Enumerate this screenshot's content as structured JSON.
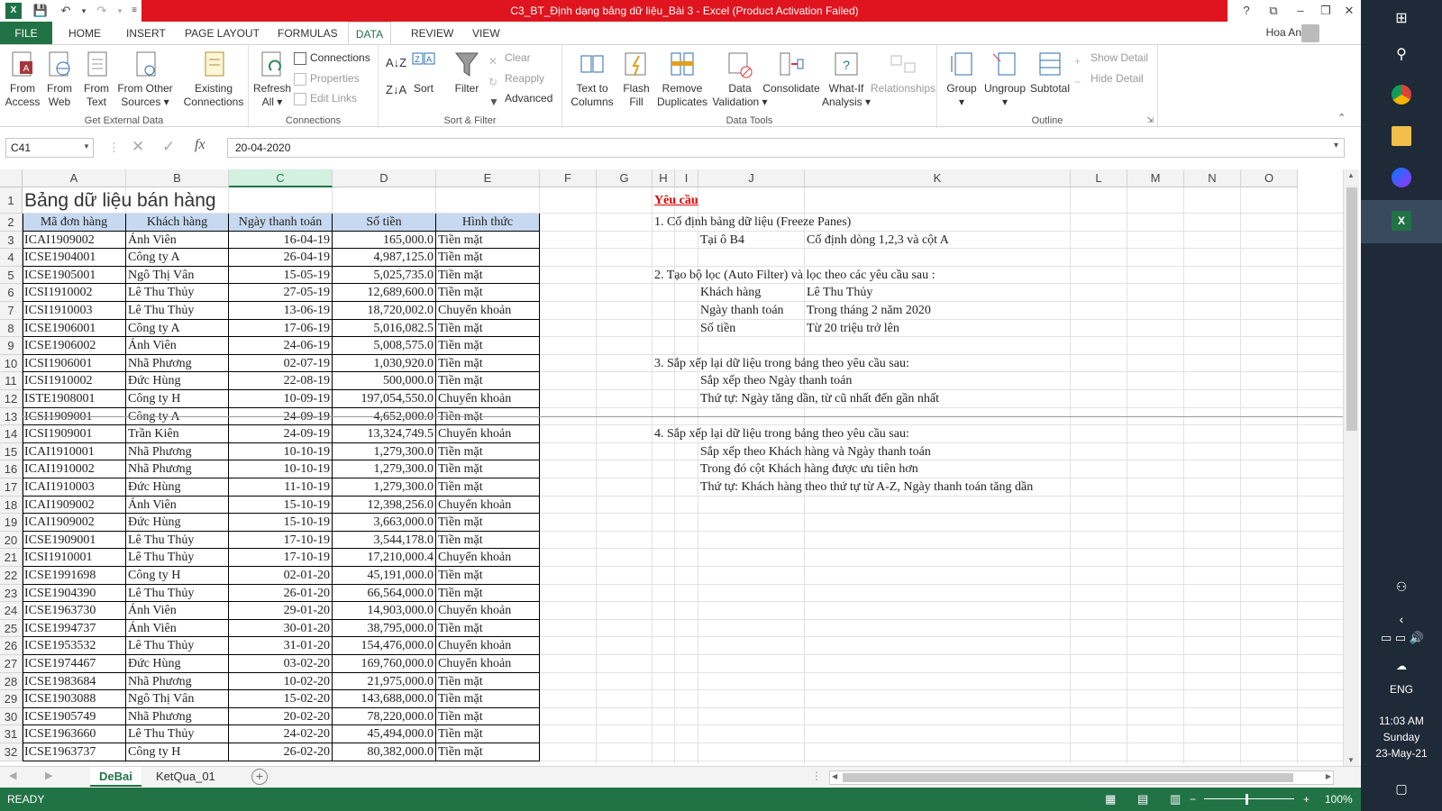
{
  "window": {
    "title": "C3_BT_Định dạng bảng dữ liệu_Bài 3 -  Excel (Product Activation Failed)",
    "user": "Hoa An",
    "help": "?"
  },
  "ribbon_tabs": [
    "FILE",
    "HOME",
    "INSERT",
    "PAGE LAYOUT",
    "FORMULAS",
    "DATA",
    "REVIEW",
    "VIEW"
  ],
  "ribbon": {
    "get_external": {
      "label": "Get External Data",
      "from_access": [
        "From",
        "Access"
      ],
      "from_web": [
        "From",
        "Web"
      ],
      "from_text": [
        "From",
        "Text"
      ],
      "from_other": [
        "From Other",
        "Sources ▾"
      ],
      "existing": [
        "Existing",
        "Connections"
      ]
    },
    "connections": {
      "label": "Connections",
      "refresh": [
        "Refresh",
        "All ▾"
      ],
      "connections": "Connections",
      "properties": "Properties",
      "edit_links": "Edit Links"
    },
    "sort_filter": {
      "label": "Sort & Filter",
      "sort": "Sort",
      "filter": "Filter",
      "clear": "Clear",
      "reapply": "Reapply",
      "advanced": "Advanced"
    },
    "data_tools": {
      "label": "Data Tools",
      "text_to_columns": [
        "Text to",
        "Columns"
      ],
      "flash_fill": [
        "Flash",
        "Fill"
      ],
      "remove_duplicates": [
        "Remove",
        "Duplicates"
      ],
      "data_validation": [
        "Data",
        "Validation ▾"
      ],
      "consolidate": "Consolidate",
      "what_if": [
        "What-If",
        "Analysis ▾"
      ],
      "relationships": "Relationships"
    },
    "outline": {
      "label": "Outline",
      "group": "Group",
      "ungroup": "Ungroup",
      "subtotal": "Subtotal",
      "show_detail": "Show Detail",
      "hide_detail": "Hide Detail"
    }
  },
  "formula_bar": {
    "name_box": "C41",
    "value": "20-04-2020"
  },
  "columns": [
    "A",
    "B",
    "C",
    "D",
    "E",
    "F",
    "G",
    "H",
    "I",
    "J",
    "K",
    "L",
    "M",
    "N",
    "O"
  ],
  "sheet_title": "Bảng dữ liệu bán hàng",
  "table_headers": [
    "Mã đơn hàng",
    "Khách hàng",
    "Ngày thanh toán",
    "Số tiền",
    "Hình thức"
  ],
  "rows": [
    [
      "ICAI1909002",
      "Ánh Viên",
      "16-04-19",
      "165,000.0",
      "Tiền mặt"
    ],
    [
      "ICSE1904001",
      "Công ty A",
      "26-04-19",
      "4,987,125.0",
      "Tiền mặt"
    ],
    [
      "ICSE1905001",
      "Ngô Thị Vân",
      "15-05-19",
      "5,025,735.0",
      "Tiền mặt"
    ],
    [
      "ICSI1910002",
      "Lê Thu Thủy",
      "27-05-19",
      "12,689,600.0",
      "Tiền mặt"
    ],
    [
      "ICSI1910003",
      "Lê Thu Thủy",
      "13-06-19",
      "18,720,002.0",
      "Chuyển khoản"
    ],
    [
      "ICSE1906001",
      "Công ty A",
      "17-06-19",
      "5,016,082.5",
      "Tiền mặt"
    ],
    [
      "ICSE1906002",
      "Ánh Viên",
      "24-06-19",
      "5,008,575.0",
      "Tiền mặt"
    ],
    [
      "ICSI1906001",
      "Nhã Phương",
      "02-07-19",
      "1,030,920.0",
      "Tiền mặt"
    ],
    [
      "ICSI1910002",
      "Đức Hùng",
      "22-08-19",
      "500,000.0",
      "Tiền mặt"
    ],
    [
      "ISTE1908001",
      "Công ty H",
      "10-09-19",
      "197,054,550.0",
      "Chuyển khoản"
    ],
    [
      "ICSI1909001",
      "Công ty A",
      "24-09-19",
      "4,652,000.0",
      "Tiền mặt"
    ],
    [
      "ICSI1909001",
      "Trần Kiên",
      "24-09-19",
      "13,324,749.5",
      "Chuyển khoản"
    ],
    [
      "ICAI1910001",
      "Nhã Phương",
      "10-10-19",
      "1,279,300.0",
      "Tiền mặt"
    ],
    [
      "ICAI1910002",
      "Nhã Phương",
      "10-10-19",
      "1,279,300.0",
      "Tiền mặt"
    ],
    [
      "ICAI1910003",
      "Đức Hùng",
      "11-10-19",
      "1,279,300.0",
      "Tiền mặt"
    ],
    [
      "ICAI1909002",
      "Ánh Viên",
      "15-10-19",
      "12,398,256.0",
      "Chuyển khoản"
    ],
    [
      "ICAI1909002",
      "Đức Hùng",
      "15-10-19",
      "3,663,000.0",
      "Tiền mặt"
    ],
    [
      "ICSE1909001",
      "Lê Thu Thủy",
      "17-10-19",
      "3,544,178.0",
      "Tiền mặt"
    ],
    [
      "ICSI1910001",
      "Lê Thu Thủy",
      "17-10-19",
      "17,210,000.4",
      "Chuyển khoản"
    ],
    [
      "ICSE1991698",
      "Công ty H",
      "02-01-20",
      "45,191,000.0",
      "Tiền mặt"
    ],
    [
      "ICSE1904390",
      "Lê Thu Thủy",
      "26-01-20",
      "66,564,000.0",
      "Tiền mặt"
    ],
    [
      "ICSE1963730",
      "Ánh Viên",
      "29-01-20",
      "14,903,000.0",
      "Chuyển khoản"
    ],
    [
      "ICSE1994737",
      "Ánh Viên",
      "30-01-20",
      "38,795,000.0",
      "Tiền mặt"
    ],
    [
      "ICSE1953532",
      "Lê Thu Thủy",
      "31-01-20",
      "154,476,000.0",
      "Chuyển khoản"
    ],
    [
      "ICSE1974467",
      "Đức Hùng",
      "03-02-20",
      "169,760,000.0",
      "Chuyển khoản"
    ],
    [
      "ICSE1983684",
      "Nhã Phương",
      "10-02-20",
      "21,975,000.0",
      "Tiền mặt"
    ],
    [
      "ICSE1903088",
      "Ngô Thị Vân",
      "15-02-20",
      "143,688,000.0",
      "Tiền mặt"
    ],
    [
      "ICSE1905749",
      "Nhã Phương",
      "20-02-20",
      "78,220,000.0",
      "Tiền mặt"
    ],
    [
      "ICSE1963660",
      "Lê Thu Thủy",
      "24-02-20",
      "45,494,000.0",
      "Tiền mặt"
    ],
    [
      "ICSE1963737",
      "Công ty H",
      "26-02-20",
      "80,382,000.0",
      "Tiền mặt"
    ]
  ],
  "requirements": {
    "heading": "Yêu cầu",
    "lines": [
      {
        "row": 2,
        "col": "H",
        "text": "1. Cố định bảng dữ liệu (Freeze Panes)"
      },
      {
        "row": 3,
        "col": "J",
        "text": "Tại ô B4"
      },
      {
        "row": 3,
        "col": "K",
        "text": "Cố định dòng 1,2,3 và cột A"
      },
      {
        "row": 5,
        "col": "H",
        "text": "2. Tạo bộ lọc (Auto Filter) và lọc theo các yêu cầu sau :"
      },
      {
        "row": 6,
        "col": "J",
        "text": "Khách hàng"
      },
      {
        "row": 6,
        "col": "K",
        "text": "Lê Thu Thủy"
      },
      {
        "row": 7,
        "col": "J",
        "text": "Ngày thanh toán"
      },
      {
        "row": 7,
        "col": "K",
        "text": "Trong tháng 2 năm 2020"
      },
      {
        "row": 8,
        "col": "J",
        "text": "Số tiền"
      },
      {
        "row": 8,
        "col": "K",
        "text": "Từ 20 triệu trở lên"
      },
      {
        "row": 10,
        "col": "H",
        "text": "3. Sắp xếp lại dữ liệu trong bảng theo yêu cầu sau:"
      },
      {
        "row": 11,
        "col": "J",
        "text": "Sắp xếp theo Ngày thanh toán"
      },
      {
        "row": 12,
        "col": "J",
        "text": "Thứ tự: Ngày tăng dần, từ cũ nhất đến gần nhất"
      },
      {
        "row": 14,
        "col": "H",
        "text": "4. Sắp xếp lại dữ liệu trong bảng theo yêu cầu sau:"
      },
      {
        "row": 15,
        "col": "J",
        "text": "Sắp xếp theo Khách hàng và Ngày thanh toán"
      },
      {
        "row": 16,
        "col": "J",
        "text": "Trong đó cột Khách hàng được ưu tiên hơn"
      },
      {
        "row": 17,
        "col": "J",
        "text": "Thứ tự: Khách hàng theo thứ tự từ A-Z, Ngày thanh toán tăng dần"
      }
    ]
  },
  "sheets": [
    "DeBai",
    "KetQua_01"
  ],
  "status": {
    "ready": "READY",
    "zoom": "100%"
  },
  "taskbar": {
    "lang": "ENG",
    "time": "11:03 AM",
    "day": "Sunday",
    "date": "23-May-21"
  },
  "colors": {
    "excel_green": "#217346",
    "title_red": "#e0141e",
    "header_blue": "#c6d9f1",
    "requirement_red": "#e00000"
  }
}
